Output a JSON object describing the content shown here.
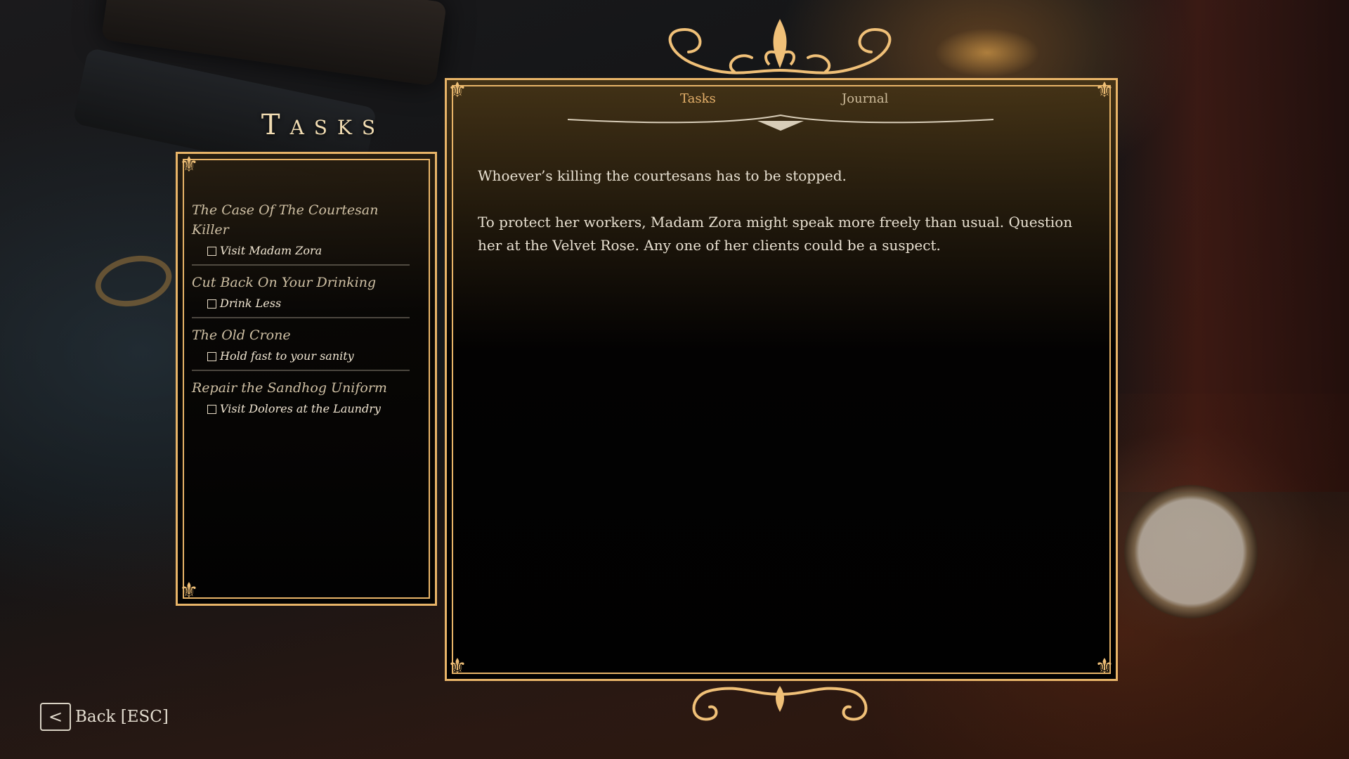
{
  "header": {
    "title": "Tasks"
  },
  "tabs": [
    {
      "label": "Tasks",
      "active": true
    },
    {
      "label": "Journal",
      "active": false
    }
  ],
  "task_list": [
    {
      "title": "The Case Of The Courtesan Killer",
      "objective": "Visit Madam Zora",
      "checked": false
    },
    {
      "title": "Cut Back On Your Drinking",
      "objective": "Drink Less",
      "checked": false
    },
    {
      "title": "The Old Crone",
      "objective": "Hold fast to your sanity",
      "checked": false
    },
    {
      "title": "Repair the Sandhog Uniform",
      "objective": "Visit Dolores at the Laundry",
      "checked": false
    }
  ],
  "detail": {
    "paragraph1": "Whoever’s killing the courtesans has to be stopped.",
    "paragraph2": "To protect her workers, Madam Zora might speak more freely than usual. Question her at the Velvet Rose. Any one of her clients could be a suspect."
  },
  "footer": {
    "back_icon": "<",
    "back_label": "Back [ESC]"
  },
  "colors": {
    "gold": "#e8b468",
    "active_tab": "#e5b06a",
    "text": "#e9e1d2"
  },
  "icons": [
    "fleur-de-lis-icon",
    "checkbox-icon",
    "chevron-left-icon",
    "corner-ornament-icon"
  ]
}
